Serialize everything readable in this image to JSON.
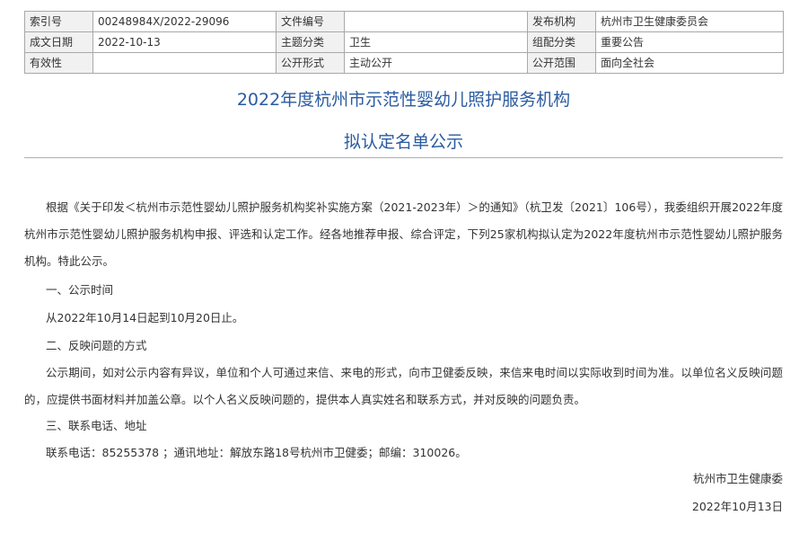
{
  "meta": {
    "index_label": "索引号",
    "index_value": "00248984X/2022-29096",
    "docnum_label": "文件编号",
    "docnum_value": "",
    "publisher_label": "发布机构",
    "publisher_value": "杭州市卫生健康委员会",
    "date_label": "成文日期",
    "date_value": "2022-10-13",
    "topic_label": "主题分类",
    "topic_value": "卫生",
    "group_label": "组配分类",
    "group_value": "重要公告",
    "validity_label": "有效性",
    "validity_value": "",
    "form_label": "公开形式",
    "form_value": "主动公开",
    "scope_label": "公开范围",
    "scope_value": "面向全社会"
  },
  "title": {
    "line1": "2022年度杭州市示范性婴幼儿照护服务机构",
    "line2": "拟认定名单公示"
  },
  "content": {
    "intro": "根据《关于印发＜杭州市示范性婴幼儿照护服务机构奖补实施方案（2021-2023年）＞的通知》（杭卫发〔2021〕106号），我委组织开展2022年度杭州市示范性婴幼儿照护服务机构申报、评选和认定工作。经各地推荐申报、综合评定，下列25家机构拟认定为2022年度杭州市示范性婴幼儿照护服务机构。特此公示。",
    "sec1_heading": "一、公示时间",
    "sec1_text": "从2022年10月14日起到10月20日止。",
    "sec2_heading": "二、反映问题的方式",
    "sec2_text": "公示期间，如对公示内容有异议，单位和个人可通过来信、来电的形式，向市卫健委反映，来信来电时间以实际收到时间为准。以单位名义反映问题的，应提供书面材料并加盖公章。以个人名义反映问题的，提供本人真实姓名和联系方式，并对反映的问题负责。",
    "sec3_heading": "三、联系电话、地址",
    "sec3_text": "联系电话：85255378 ；通讯地址：解放东路18号杭州市卫健委；邮编：310026。"
  },
  "signature": {
    "org": "杭州市卫生健康委",
    "date": "2022年10月13日"
  }
}
